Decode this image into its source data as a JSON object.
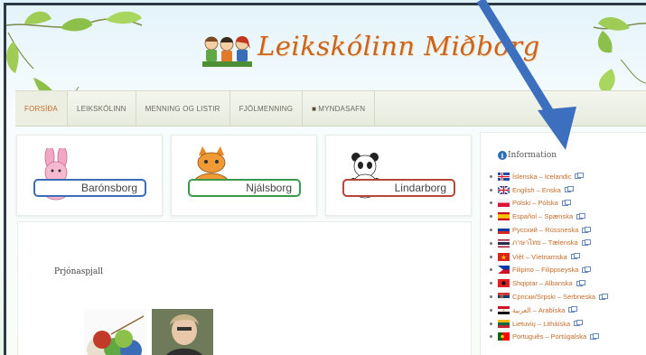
{
  "site": {
    "title": "Leikskólinn Miðborg"
  },
  "nav": {
    "items": [
      {
        "label": "FORSÍÐA",
        "active": true
      },
      {
        "label": "LEIKSKÓLINN",
        "active": false
      },
      {
        "label": "MENNING OG LISTIR",
        "active": false
      },
      {
        "label": "FJÖLMENNING",
        "active": false
      },
      {
        "label": "MYNDASAFN",
        "active": false,
        "icon": "camera-icon"
      }
    ]
  },
  "schools": [
    {
      "name": "Barónsborg",
      "color": "#3a6db5",
      "mascot": "bunny"
    },
    {
      "name": "Njálsborg",
      "color": "#3a9a4c",
      "mascot": "cat"
    },
    {
      "name": "Lindarborg",
      "color": "#b5473a",
      "mascot": "panda"
    }
  ],
  "post": {
    "title": "Prjónaspjall"
  },
  "sidebar": {
    "title": "Information",
    "languages": [
      {
        "label": "Íslenska – Icelandic",
        "flag": "iceland-flag"
      },
      {
        "label": "English – Enska",
        "flag": "uk-flag"
      },
      {
        "label": "Polski – Pólska",
        "flag": "poland-flag"
      },
      {
        "label": "Español – Spænska",
        "flag": "spain-flag"
      },
      {
        "label": "Русский – Rússneska",
        "flag": "russia-flag"
      },
      {
        "label": "ภาษาไทย – Tælenska",
        "flag": "thailand-flag"
      },
      {
        "label": "Việt – Víetnamska",
        "flag": "vietnam-flag"
      },
      {
        "label": "Filipino – Filippseyska",
        "flag": "philippines-flag"
      },
      {
        "label": "Shqiptar – Albanska",
        "flag": "albania-flag"
      },
      {
        "label": "Српски/Srpski – Serbneska",
        "flag": "serbia-flag"
      },
      {
        "label": "العربية – Arabíska",
        "flag": "egypt-flag"
      },
      {
        "label": "Lietuvių – Litháíska",
        "flag": "lithuania-flag"
      },
      {
        "label": "Português – Portúgalska",
        "flag": "portugal-flag"
      }
    ]
  },
  "colors": {
    "brand": "#c9651e",
    "link": "#c46c2c",
    "arrow": "#3d6fbf"
  }
}
